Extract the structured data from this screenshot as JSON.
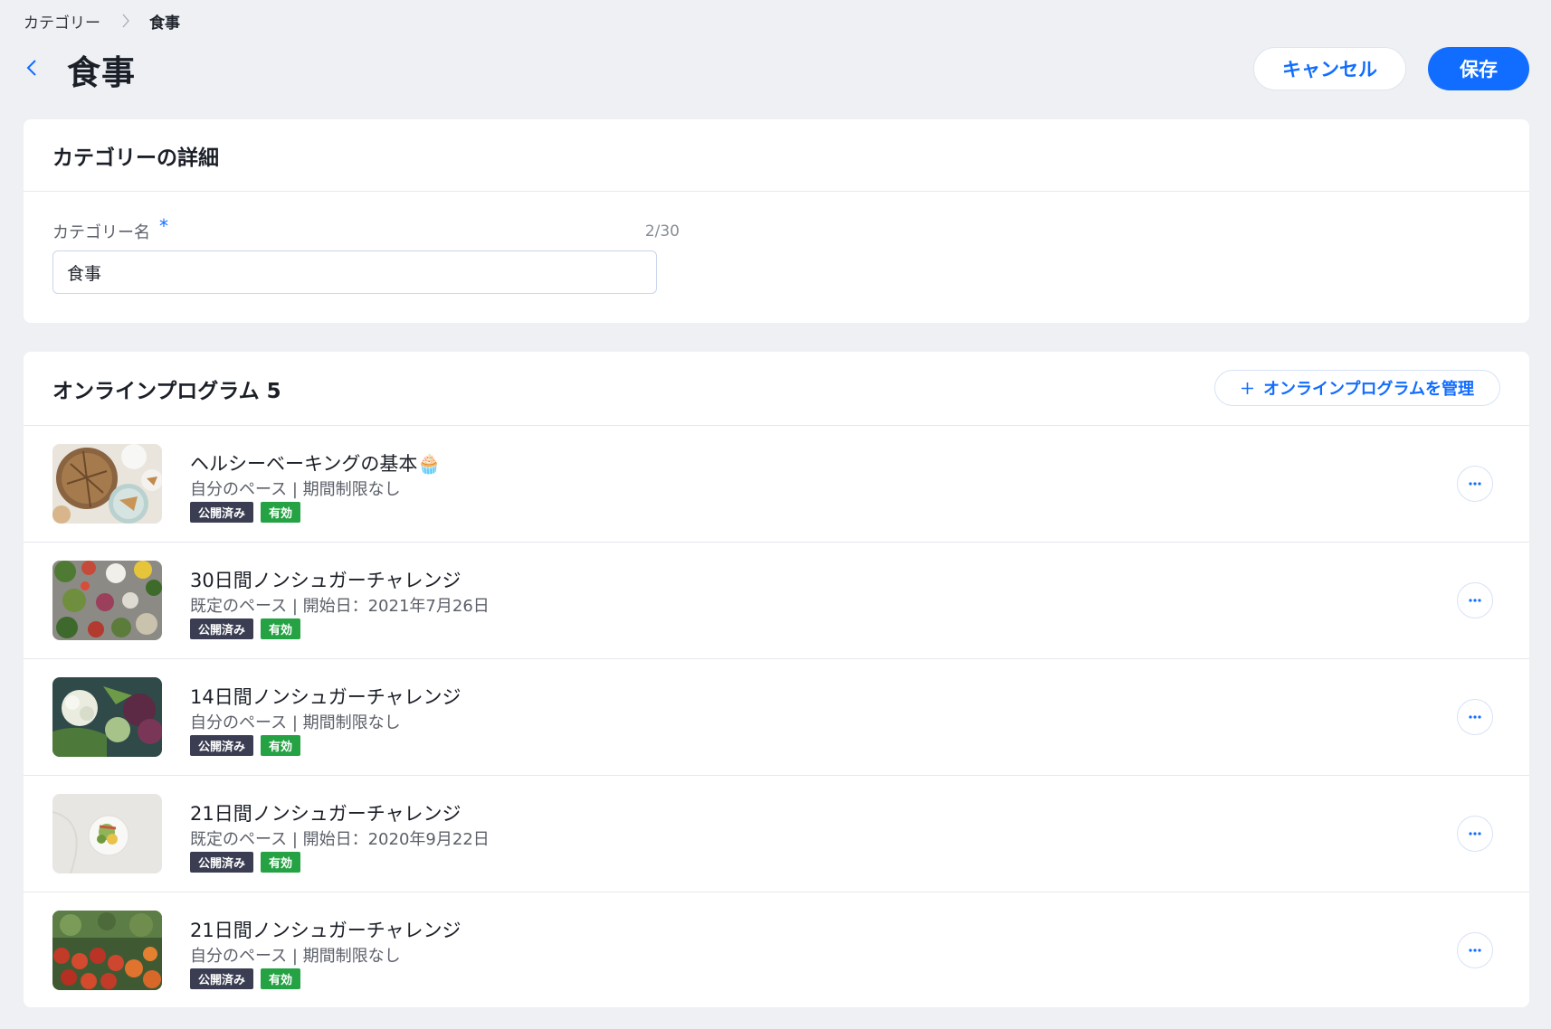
{
  "breadcrumb": {
    "parent": "カテゴリー",
    "current": "食事"
  },
  "header": {
    "title": "食事",
    "cancel_label": "キャンセル",
    "save_label": "保存"
  },
  "details": {
    "title": "カテゴリーの詳細",
    "field_label": "カテゴリー名",
    "required_mark": "*",
    "char_count": "2/30",
    "value": "食事"
  },
  "programs": {
    "title": "オンラインプログラム 5",
    "manage_label": "オンラインプログラムを管理",
    "items": [
      {
        "title": "ヘルシーベーキングの基本🧁",
        "subtitle": "自分のペース | 期間制限なし",
        "status": "公開済み",
        "state": "有効",
        "thumbnail": "baking-image"
      },
      {
        "title": "30日間ノンシュガーチャレンジ",
        "subtitle": "既定のペース | 開始日：2021年7月26日",
        "status": "公開済み",
        "state": "有効",
        "thumbnail": "vegetables-table-image"
      },
      {
        "title": "14日間ノンシュガーチャレンジ",
        "subtitle": "自分のペース | 期間制限なし",
        "status": "公開済み",
        "state": "有効",
        "thumbnail": "cauliflower-image"
      },
      {
        "title": "21日間ノンシュガーチャレンジ",
        "subtitle": "既定のペース | 開始日：2020年9月22日",
        "status": "公開済み",
        "state": "有効",
        "thumbnail": "salad-plate-image"
      },
      {
        "title": "21日間ノンシュガーチャレンジ",
        "subtitle": "自分のペース | 期間制限なし",
        "status": "公開済み",
        "state": "有効",
        "thumbnail": "tomatoes-market-image"
      }
    ]
  },
  "colors": {
    "accent": "#116dff",
    "published_badge": "#3b3e52",
    "active_badge": "#25a243",
    "background": "#eef0f4"
  }
}
